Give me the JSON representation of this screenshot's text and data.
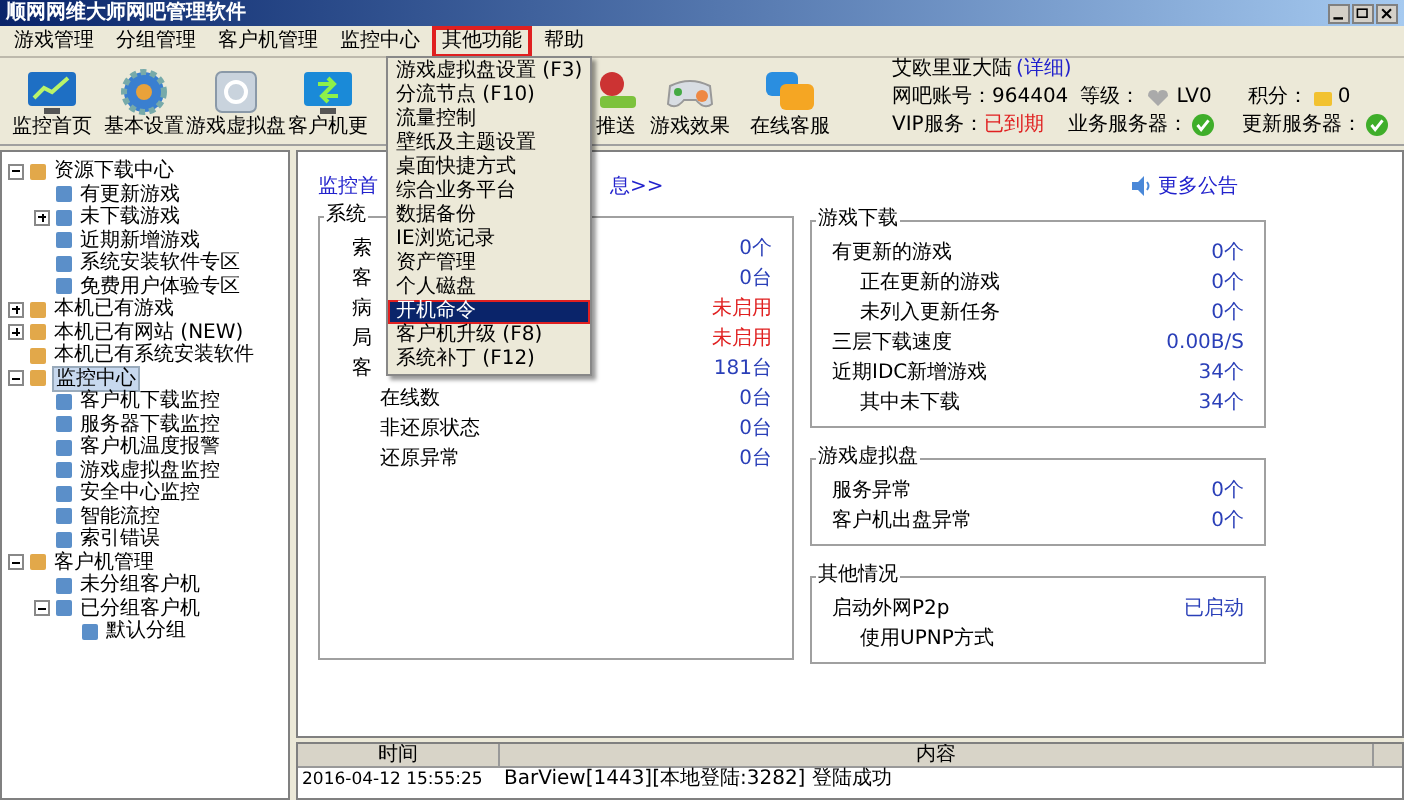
{
  "window": {
    "title": "顺网网维大师网吧管理软件"
  },
  "menu": [
    {
      "label": "游戏管理",
      "selected": false
    },
    {
      "label": "分组管理",
      "selected": false
    },
    {
      "label": "客户机管理",
      "selected": false
    },
    {
      "label": "监控中心",
      "selected": false
    },
    {
      "label": "其他功能",
      "selected": true
    },
    {
      "label": "帮助",
      "selected": false
    }
  ],
  "dropdown": [
    {
      "label": "游戏虚拟盘设置 (F3)",
      "selected": false
    },
    {
      "label": "分流节点 (F10)",
      "selected": false
    },
    {
      "label": "流量控制",
      "selected": false
    },
    {
      "label": "壁纸及主题设置",
      "selected": false
    },
    {
      "label": "桌面快捷方式",
      "selected": false
    },
    {
      "label": "综合业务平台",
      "selected": false
    },
    {
      "label": "数据备份",
      "selected": false
    },
    {
      "label": "IE浏览记录",
      "selected": false
    },
    {
      "label": "资产管理",
      "selected": false
    },
    {
      "label": "个人磁盘",
      "selected": false
    },
    {
      "label": "开机命令",
      "selected": true
    },
    {
      "label": "客户机升级 (F8)",
      "selected": false
    },
    {
      "label": "系统补丁 (F12)",
      "selected": false
    }
  ],
  "toolbar": [
    "监控首页",
    "基本设置",
    "游戏虚拟盘",
    "客户机更",
    "推送",
    "游戏效果",
    "在线客服"
  ],
  "account": {
    "name": "艾欧里亚大陆",
    "detail_link": "(详细)",
    "account_label": "网吧账号：964404",
    "level_label": "等级：",
    "level": "LV0",
    "points_label": "积分：",
    "points": "0",
    "vip_label": "VIP服务：",
    "vip_status": "已到期",
    "servers": [
      {
        "label": "业务服务器：",
        "ok": true
      },
      {
        "label": "更新服务器：",
        "ok": true
      }
    ]
  },
  "tree": [
    {
      "label": "资源下载中心",
      "expanded": true,
      "selected": false,
      "children": [
        {
          "label": "有更新游戏",
          "selected": false
        },
        {
          "label": "未下载游戏",
          "expanded": false,
          "selected": false
        },
        {
          "label": "近期新增游戏",
          "selected": false
        },
        {
          "label": "系统安装软件专区",
          "selected": false
        },
        {
          "label": "免费用户体验专区",
          "selected": false
        }
      ]
    },
    {
      "label": "本机已有游戏",
      "expanded": false,
      "selected": false
    },
    {
      "label": "本机已有网站 (NEW)",
      "expanded": false,
      "selected": false
    },
    {
      "label": "本机已有系统安装软件",
      "selected": false
    },
    {
      "label": "监控中心",
      "expanded": true,
      "selected": true,
      "children": [
        {
          "label": "客户机下载监控",
          "selected": false
        },
        {
          "label": "服务器下载监控",
          "selected": false
        },
        {
          "label": "客户机温度报警",
          "selected": false
        },
        {
          "label": "游戏虚拟盘监控",
          "selected": false
        },
        {
          "label": "安全中心监控",
          "selected": false
        },
        {
          "label": "智能流控",
          "selected": false
        },
        {
          "label": "索引错误",
          "selected": false
        }
      ]
    },
    {
      "label": "客户机管理",
      "expanded": true,
      "selected": false,
      "children": [
        {
          "label": "未分组客户机",
          "selected": false
        },
        {
          "label": "已分组客户机",
          "expanded": true,
          "selected": false,
          "children": [
            {
              "label": "默认分组",
              "selected": false
            }
          ]
        }
      ]
    }
  ],
  "main": {
    "header_link": "监控首",
    "header_link_end": "息>>",
    "announcement": "更多公告",
    "left_card": {
      "legend": "系统",
      "rows": [
        {
          "label": "索",
          "value": "0个",
          "alert": false
        },
        {
          "label": "客",
          "value": "0台",
          "alert": false
        },
        {
          "label": "病",
          "value": "未启用",
          "alert": true
        },
        {
          "label": "局",
          "value": "未启用",
          "alert": true
        },
        {
          "label": "客",
          "value": "181台",
          "alert": false,
          "children": [
            {
              "label": "在线数",
              "value": "0台",
              "alert": false
            },
            {
              "label": "非还原状态",
              "value": "0台",
              "alert": false
            },
            {
              "label": "还原异常",
              "value": "0台",
              "alert": false
            }
          ]
        }
      ]
    },
    "right_cards": [
      {
        "legend": "游戏下载",
        "rows": [
          {
            "label": "有更新的游戏",
            "value": "0个",
            "children": [
              {
                "label": "正在更新的游戏",
                "value": "0个"
              },
              {
                "label": "未列入更新任务",
                "value": "0个"
              }
            ]
          },
          {
            "label": "三层下载速度",
            "value": "0.00B/S"
          },
          {
            "label": "近期IDC新增游戏",
            "value": "34个",
            "children": [
              {
                "label": "其中未下载",
                "value": "34个"
              }
            ]
          }
        ]
      },
      {
        "legend": "游戏虚拟盘",
        "rows": [
          {
            "label": "服务异常",
            "value": "0个"
          },
          {
            "label": "客户机出盘异常",
            "value": "0个"
          }
        ]
      },
      {
        "legend": "其他情况",
        "rows": [
          {
            "label": "启动外网P2p",
            "value": "已启动",
            "children": [
              {
                "label": "使用UPNP方式"
              }
            ]
          }
        ]
      }
    ]
  },
  "log": {
    "columns": [
      "时间",
      "内容"
    ],
    "rows": [
      [
        "2016-04-12 15:55:25",
        "BarView[1443][本地登陆:3282] 登陆成功"
      ]
    ]
  }
}
